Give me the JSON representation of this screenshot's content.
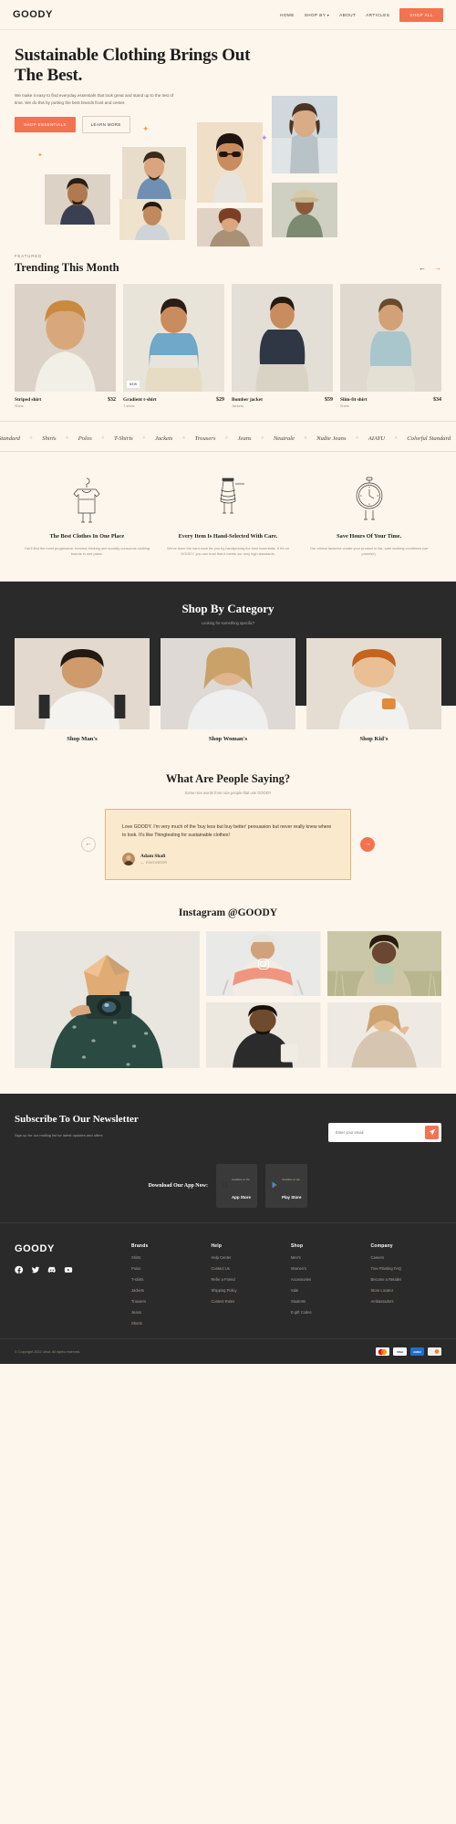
{
  "header": {
    "logo": "GOODY",
    "nav": [
      {
        "label": "HOME"
      },
      {
        "label": "SHOP BY"
      },
      {
        "label": "ABOUT"
      },
      {
        "label": "ARTICLES"
      }
    ],
    "cta": "SHOP ALL"
  },
  "hero": {
    "title": "Sustainable Clothing Brings Out The Best.",
    "subtitle": "We make it easy to find everyday essentials that look great and stand up to the test of time. We do this by putting the best brands front and center.",
    "primary_cta": "SHOP ESSENTIALS",
    "secondary_cta": "LEARN MORE"
  },
  "trending": {
    "eyebrow": "FEATURED",
    "title": "Trending This Month",
    "prev_icon": "arrow-left",
    "next_icon": "arrow-right",
    "products": [
      {
        "name": "Striped shirt",
        "category": "Shirts",
        "price": "$32",
        "badge": ""
      },
      {
        "name": "Gradient t-shirt",
        "category": "T-shirts",
        "price": "$29",
        "badge": "NEW"
      },
      {
        "name": "Bomber jacket",
        "category": "Jackets",
        "price": "$59",
        "badge": ""
      },
      {
        "name": "Slim-fit shirt",
        "category": "Shirts",
        "price": "$34",
        "badge": ""
      }
    ]
  },
  "marquee": {
    "separator": "✧",
    "items": [
      "Colorful Standard",
      "Shirts",
      "Polos",
      "T-Shirts",
      "Jackets",
      "Trousers",
      "Jeans",
      "Neutrale",
      "Nudie Jeans",
      "AIAYU"
    ]
  },
  "features": [
    {
      "icon": "tshirt-hanger-icon",
      "title": "The Best Clothes In One Place",
      "desc": "You'll find the most progressive, forward-thinking and socially conscious clothing brands in one place."
    },
    {
      "icon": "thread-spool-icon",
      "title": "Every Item Is Hand-Selected With Care.",
      "desc": "We've done the hard work for you by handpicking the best essentials. If it's on GOODY, you can trust that it meets our very high standards."
    },
    {
      "icon": "stopwatch-icon",
      "title": "Save Hours Of Your Time.",
      "desc": "Our ethical factories create your product in fair, safe working conditions (we promise)."
    }
  ],
  "category": {
    "title": "Shop By Category",
    "subtitle": "Looking for something specific?",
    "cards": [
      {
        "label": "Shop Man's"
      },
      {
        "label": "Shop Woman's"
      },
      {
        "label": "Shop Kid's"
      }
    ]
  },
  "testimonial": {
    "title": "What Are People Saying?",
    "subtitle": "Some nice words from nice people that use GOODY",
    "quote": "Love GOODY. I'm very much of the 'buy less but buy better' persuasion but never really knew where to look. It's like Thingtesting for sustainable clothes!",
    "author_name": "Adam Shafi",
    "author_role": "ENGINEER",
    "prev_icon": "arrow-left",
    "next_icon": "arrow-right"
  },
  "instagram": {
    "title": "Instagram @GOODY",
    "badge_icon": "instagram-icon"
  },
  "newsletter": {
    "title": "Subscribe To Our Newsletter",
    "subtitle": "Sign up for our mailing list for latest updates and offers",
    "placeholder": "Enter your email",
    "value": "",
    "submit_icon": "send-icon"
  },
  "app": {
    "text": "Download Our App Now:",
    "stores": [
      {
        "icon": "apple-icon",
        "top": "Available on the",
        "name": "App Store"
      },
      {
        "icon": "play-icon",
        "top": "Available on the",
        "name": "Play Store"
      }
    ]
  },
  "footer": {
    "logo": "GOODY",
    "social": [
      {
        "icon": "facebook-icon"
      },
      {
        "icon": "twitter-icon"
      },
      {
        "icon": "discord-icon"
      },
      {
        "icon": "youtube-icon"
      }
    ],
    "columns": [
      {
        "heading": "Brands",
        "links": [
          "Shirts",
          "Polos",
          "T-shirts",
          "Jackets",
          "Trousers",
          "Jeans",
          "Shorts"
        ]
      },
      {
        "heading": "Help",
        "links": [
          "Help Center",
          "Contact Us",
          "Refer a Friend",
          "Shipping Policy",
          "Contest Rules"
        ]
      },
      {
        "heading": "Shop",
        "links": [
          "Men's",
          "Women's",
          "Accessories",
          "Sale",
          "Students",
          "E-gift Codes"
        ]
      },
      {
        "heading": "Company",
        "links": [
          "Careers",
          "Tree Planting FAQ",
          "Become a Retailer",
          "Store Locator",
          "Ambassadors"
        ]
      }
    ],
    "copyright": "© Copyright 2022 uihut. All rights reserved.",
    "payments": [
      {
        "name": "mastercard"
      },
      {
        "name": "visa"
      },
      {
        "name": "amex"
      },
      {
        "name": "discover"
      }
    ]
  },
  "colors": {
    "accent": "#f4724f",
    "cream": "#fdf6ec",
    "dark": "#2a2a2a",
    "tan": "#fbe9cd"
  }
}
